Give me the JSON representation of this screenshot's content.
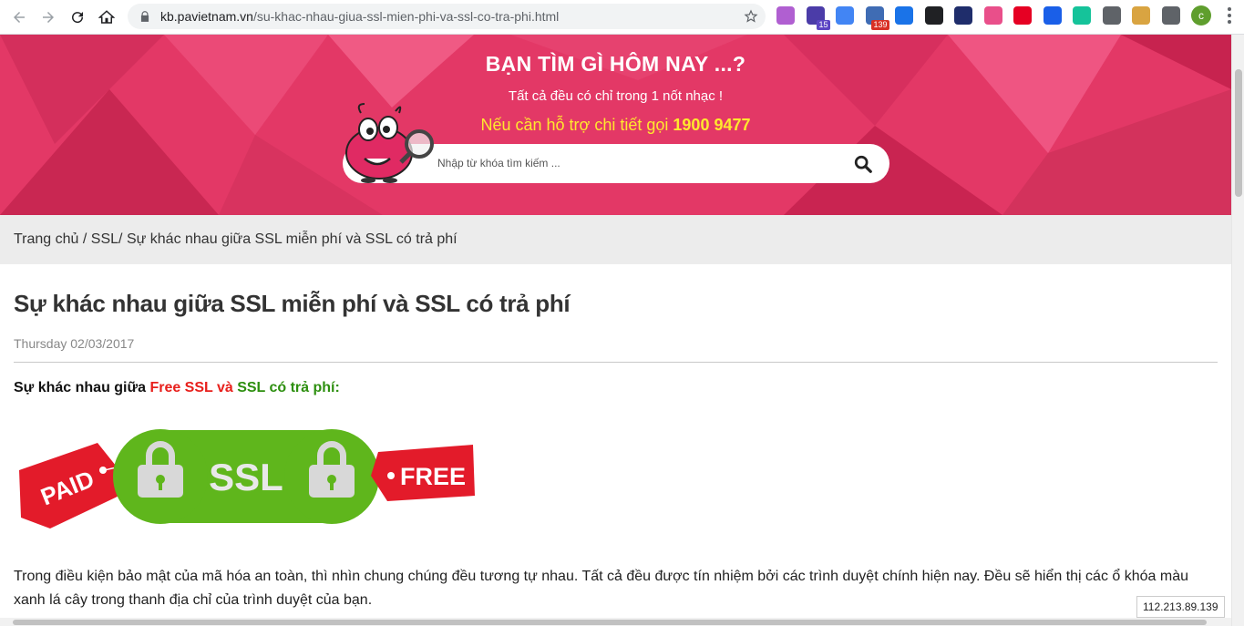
{
  "browser": {
    "url_host": "kb.pavietnam.vn",
    "url_path": "/su-khac-nhau-giua-ssl-mien-phi-va-ssl-co-tra-phi.html",
    "extensions": [
      {
        "icon": "purple-circle-icon",
        "color": "#b05fd1",
        "badge": ""
      },
      {
        "icon": "graduation-cap-icon",
        "color": "#4b3ca8",
        "badge": "15",
        "badge_color": "#5c45c4"
      },
      {
        "icon": "translate-icon",
        "color": "#4285f4",
        "badge": ""
      },
      {
        "icon": "calendar-icon",
        "color": "#3f6cb4",
        "badge": "139",
        "badge_color": "#d93025"
      },
      {
        "icon": "screen-icon",
        "color": "#1a73e8",
        "badge": ""
      },
      {
        "icon": "sync-icon",
        "color": "#202124",
        "badge": ""
      },
      {
        "icon": "ip-icon",
        "color": "#1f2d6b",
        "badge": ""
      },
      {
        "icon": "color-ring-icon",
        "color": "#e94f8a",
        "badge": ""
      },
      {
        "icon": "pinterest-icon",
        "color": "#e60023",
        "badge": ""
      },
      {
        "icon": "bolt-icon",
        "color": "#1a5fe8",
        "badge": ""
      },
      {
        "icon": "grammarly-icon",
        "color": "#15c39a",
        "badge": ""
      },
      {
        "icon": "recycle-icon",
        "color": "#5f6368",
        "badge": ""
      },
      {
        "icon": "pattern-icon",
        "color": "#d9a441",
        "badge": ""
      },
      {
        "icon": "puzzle-icon",
        "color": "#5f6368",
        "badge": ""
      }
    ],
    "avatar_letter": "c"
  },
  "hero": {
    "title": "BẠN TÌM GÌ HÔM NAY ...?",
    "subtitle": "Tất cả đều có chỉ trong 1 nốt nhạc !",
    "hotline_prefix": "Nếu cần hỗ trợ chi tiết gọi ",
    "hotline_number": "1900 9477",
    "search_placeholder": "Nhập từ khóa tìm kiếm ..."
  },
  "breadcrumb": {
    "home": "Trang chủ",
    "sep1": " / ",
    "category": "SSL",
    "sep2": "/ ",
    "current": "Sự khác nhau giữa SSL miễn phí và SSL có trả phí"
  },
  "article": {
    "title": "Sự khác nhau giữa SSL miễn phí và SSL có trả phí",
    "date": "Thursday 02/03/2017",
    "lead_prefix": "Sự khác nhau giữa ",
    "lead_free": "Free SSL",
    "lead_and": " và ",
    "lead_paid": "SSL có trả phí:",
    "image_text": {
      "paid": "PAID",
      "ssl": "SSL",
      "free": "FREE"
    },
    "paragraph": "Trong điều kiện bảo mật của mã hóa an toàn, thì nhìn chung chúng đều tương tự nhau. Tất cả đều được tín nhiệm bởi các trình duyệt chính hiện nay. Đều sẽ  hiển thị các ổ khóa màu xanh lá cây trong thanh địa chỉ của trình duyệt của bạn."
  },
  "status_ip": "112.213.89.139",
  "colors": {
    "hero_bg": "#e33866",
    "hotline": "#ffe82e",
    "free_red": "#e8201c",
    "paid_green": "#2d8f0f",
    "ssl_green": "#5fb61c"
  }
}
